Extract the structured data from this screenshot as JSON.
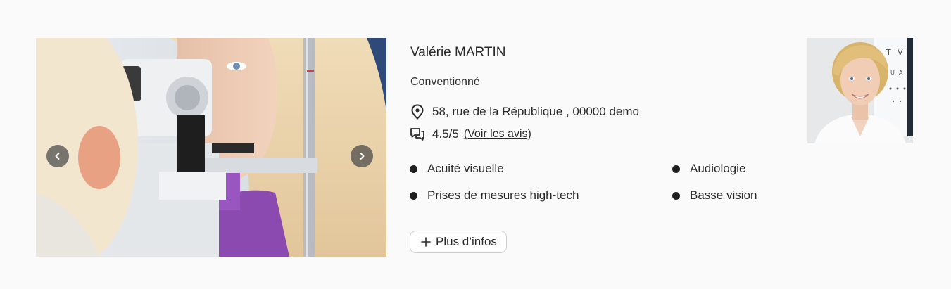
{
  "carousel": {
    "photo": "eye-exam-photo",
    "prev_icon": "chevron-left-icon",
    "next_icon": "chevron-right-icon"
  },
  "practitioner": {
    "name": "Valérie MARTIN",
    "status": "Conventionné",
    "address": "58, rue de la République , 00000 demo",
    "address_icon": "location-pin-icon",
    "rating": "4.5/5",
    "rating_icon": "reviews-chat-icon",
    "reviews_link": "(Voir les avis)",
    "avatar": "practitioner-portrait"
  },
  "services": [
    "Acuité visuelle",
    "Audiologie",
    "Prises de mesures high-tech",
    "Basse vision"
  ],
  "actions": {
    "more_info": "Plus d’infos",
    "more_info_icon": "plus-icon"
  }
}
